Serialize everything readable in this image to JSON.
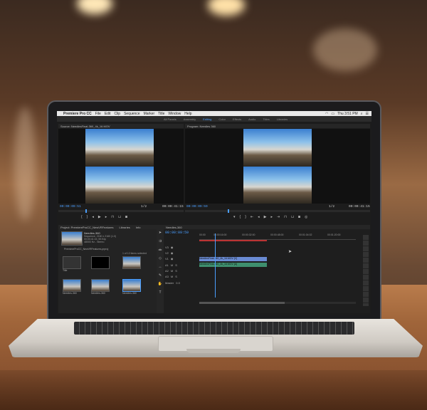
{
  "menubar": {
    "apple": "",
    "app_name": "Premiere Pro CC",
    "items": [
      "File",
      "Edit",
      "Clip",
      "Sequence",
      "Marker",
      "Title",
      "Window",
      "Help"
    ],
    "clock": "Thu 3:51 PM"
  },
  "workspaces": [
    "All Panels",
    "Assembly",
    "Editing",
    "Color",
    "Effects",
    "Audio",
    "Titles",
    "Libraries"
  ],
  "active_workspace": "Editing",
  "source_monitor": {
    "tab": "Source: NeedlesFinal-360_4k_16.MOV",
    "timecode_left": "00:00:09:51",
    "fraction": "1/2",
    "timecode_right": "00:00:41:15"
  },
  "program_monitor": {
    "tab": "Program: Needles 360",
    "timecode_left": "00:00:09:59",
    "fraction": "1/2",
    "timecode_right": "00:00:41:15"
  },
  "project": {
    "tabs": [
      "Project: PremiereProCC_NewVRFeatures",
      "Libraries",
      "Info"
    ],
    "sequence_name": "Needles-360",
    "sequence_info": "Sequence, 2160 x 2160 (1.0)",
    "duration": "00:00:41:15, 59.94p",
    "audio": "48000 Hz - Stereo",
    "file": "PremiereProCC_NewVRFeatures.prproj",
    "items_selected": "1 of 12 items selected",
    "thumbs": [
      {
        "label": "Title",
        "kind": "folder"
      },
      {
        "label": "Needles-360",
        "kind": "black"
      },
      {
        "label": "Needles-360",
        "kind": "vr"
      },
      {
        "label": "Needles-360",
        "kind": "vr"
      },
      {
        "label": "Needles-360",
        "kind": "vr"
      },
      {
        "label": "Needles-360",
        "kind": "vr"
      }
    ]
  },
  "timeline": {
    "tab": "Needles-360",
    "timecode": "00:00:09:59",
    "ruler": [
      "00:00",
      "00:00:16:00",
      "00:00:32:00",
      "00:00:48:00",
      "00:01:04:02",
      "00:01:20:00"
    ],
    "tracks": [
      "V3",
      "V2",
      "V1",
      "A1",
      "A2",
      "A3",
      "Master"
    ],
    "master_value": "0.0",
    "clip_video": "NeedlesFinal-360_4k_16.MOV [V]",
    "clip_audio": "NeedlesFinal-360_4k_16.MOV [A]"
  }
}
